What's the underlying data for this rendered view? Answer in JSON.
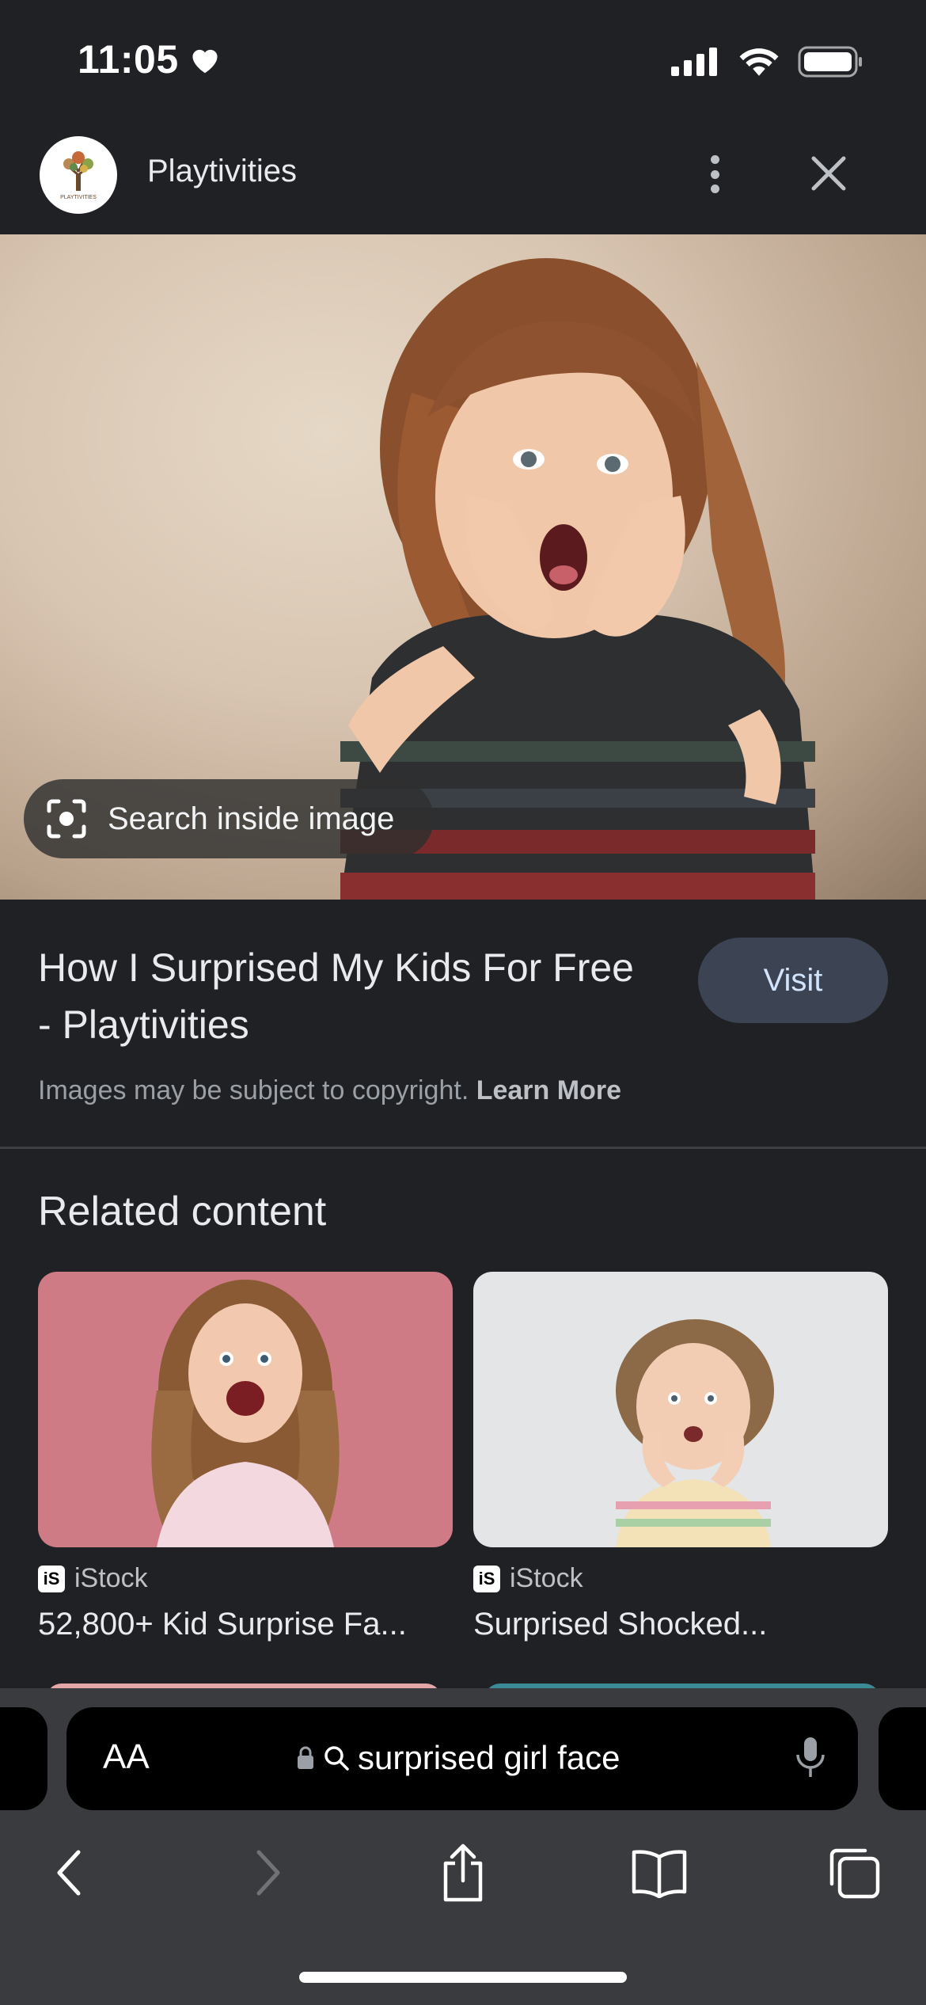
{
  "status_bar": {
    "time": "11:05"
  },
  "header": {
    "site_name": "Playtivities",
    "avatar_text": "PLAYTIVITIES"
  },
  "hero": {
    "search_inside_label": "Search inside image"
  },
  "result": {
    "title": "How I Surprised My Kids For Free - Playtivities",
    "visit_label": "Visit",
    "copyright_text": "Images may be subject to copyright.",
    "learn_more": "Learn More"
  },
  "related": {
    "title": "Related content",
    "cards": [
      {
        "badge": "iS",
        "source": "iStock",
        "caption": "52,800+ Kid Surprise Fa..."
      },
      {
        "badge": "iS",
        "source": "iStock",
        "caption": "Surprised Shocked..."
      }
    ]
  },
  "browser": {
    "aa_label": "AA",
    "url": "surprised girl face"
  },
  "icons": {
    "status": [
      "heart-icon",
      "cellular-signal-icon",
      "wifi-icon",
      "battery-icon"
    ],
    "header": [
      "more-vert-icon",
      "close-icon"
    ],
    "nav": [
      "back-icon",
      "forward-icon",
      "share-icon",
      "bookmarks-icon",
      "tabs-icon"
    ]
  },
  "colors": {
    "background": "#202124",
    "visit_button": "#3c4454",
    "browser_chrome": "#3a3b3e"
  }
}
